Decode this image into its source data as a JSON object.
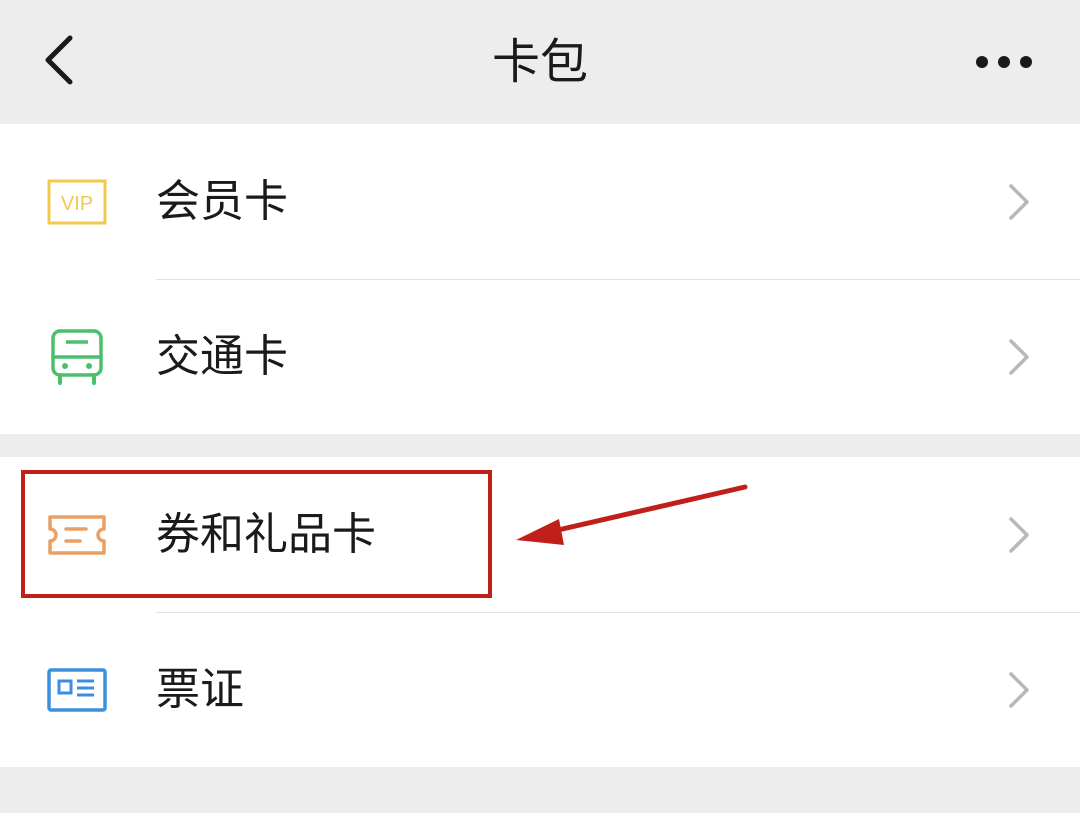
{
  "nav": {
    "title": "卡包",
    "back_icon": "back-chevron-icon",
    "more_icon": "more-dots-icon"
  },
  "groups": [
    {
      "items": [
        {
          "label": "会员卡",
          "icon": "vip-card-icon",
          "icon_color": "#f2c94c"
        },
        {
          "label": "交通卡",
          "icon": "bus-icon",
          "icon_color": "#4cbf6c"
        }
      ]
    },
    {
      "items": [
        {
          "label": "券和礼品卡",
          "icon": "coupon-icon",
          "icon_color": "#e9a064"
        },
        {
          "label": "票证",
          "icon": "id-card-icon",
          "icon_color": "#3b8fe0"
        }
      ]
    }
  ],
  "vip_icon_text": "VIP",
  "annotation": {
    "highlight_color": "#c0201a",
    "target_item": "券和礼品卡"
  },
  "colors": {
    "background": "#ededed",
    "card": "#ffffff",
    "text": "#1a1a1a",
    "chevron": "#b8b8b8"
  }
}
